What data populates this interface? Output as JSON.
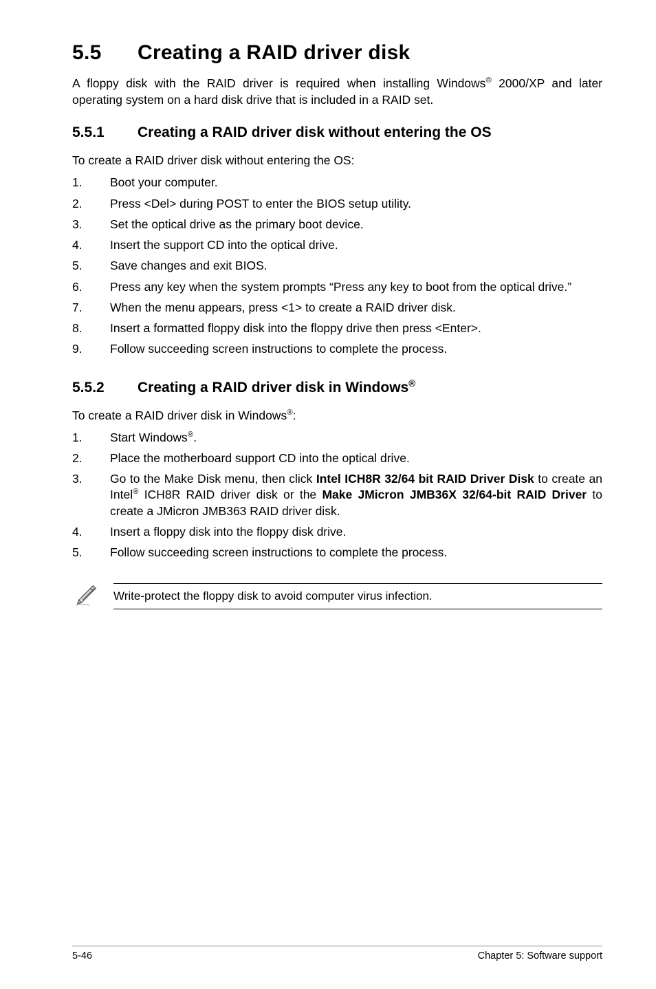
{
  "heading": {
    "num": "5.5",
    "title": "Creating a RAID driver disk"
  },
  "intro": {
    "pre": "A floppy disk with the RAID driver is required when installing Windows",
    "sup": "®",
    "post": " 2000/XP and later operating system on a hard disk drive that is included in a RAID set."
  },
  "section1": {
    "num": "5.5.1",
    "title": "Creating a RAID driver disk without entering the OS",
    "subtitle": "To create a RAID driver disk without entering the OS:",
    "steps": [
      "Boot your computer.",
      "Press <Del> during POST to enter the BIOS setup utility.",
      "Set the optical drive as the primary boot device.",
      "Insert the support CD into the optical drive.",
      "Save changes and exit BIOS.",
      "Press any key when the system prompts “Press any key to boot from the optical drive.”",
      "When the menu appears, press <1> to create a RAID driver disk.",
      "Insert a formatted floppy disk into the floppy drive then press <Enter>.",
      "Follow succeeding screen instructions to complete the process."
    ]
  },
  "section2": {
    "num": "5.5.2",
    "title_pre": "Creating a RAID driver disk in Windows",
    "title_sup": "®",
    "subtitle_pre": "To create a RAID driver disk in Windows",
    "subtitle_sup": "®",
    "subtitle_post": ":",
    "steps_plain": [
      "",
      "Place the motherboard support CD into the optical drive.",
      "",
      "Insert a floppy disk into the floppy disk drive.",
      "Follow succeeding screen instructions to complete the process."
    ],
    "step1_pre": "Start Windows",
    "step1_sup": "®",
    "step1_post": ".",
    "step3_a": "Go to the Make Disk menu, then click ",
    "step3_b": "Intel ICH8R 32/64 bit RAID Driver Disk",
    "step3_c": " to create an Intel",
    "step3_sup": "®",
    "step3_d": " ICH8R RAID driver disk or the ",
    "step3_e": "Make JMicron JMB36X 32/64-bit RAID Driver",
    "step3_f": " to create a JMicron JMB363 RAID driver disk."
  },
  "note": "Write-protect the floppy disk to avoid computer virus infection.",
  "footer": {
    "left": "5-46",
    "right": "Chapter 5: Software support"
  }
}
